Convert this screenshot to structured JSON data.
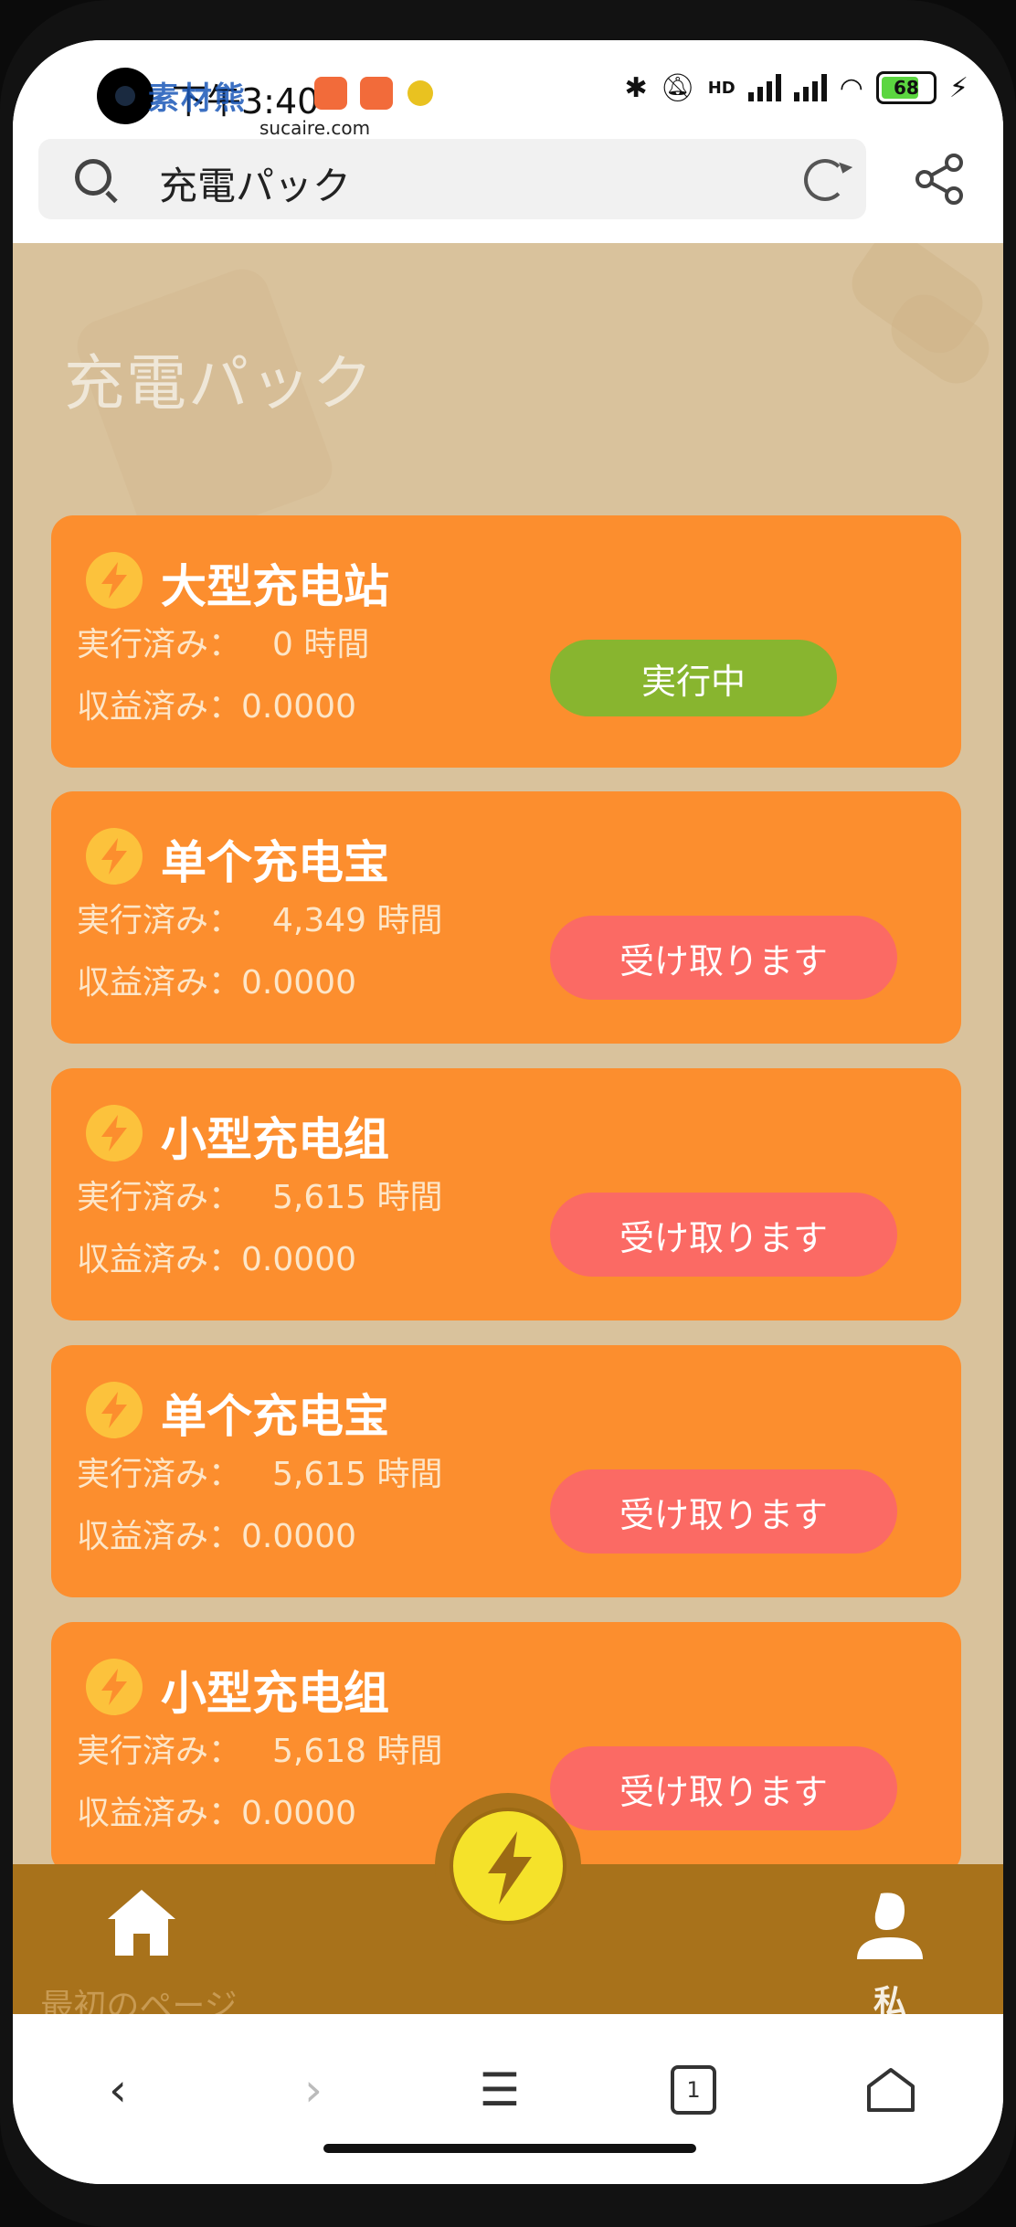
{
  "status_bar": {
    "time": "下午3:40",
    "watermark": "素材熊",
    "watermark_sub": "sucaire.com",
    "network": "HD",
    "battery": "68"
  },
  "search": {
    "query": "充電パック"
  },
  "page": {
    "title": "充電パック"
  },
  "cards": [
    {
      "name": "大型充电站",
      "run_label": "実行済み：",
      "run_value": "0 時間",
      "earn_label": "収益済み：",
      "earn_value": "0.0000",
      "button": "実行中",
      "state": "running"
    },
    {
      "name": "单个充电宝",
      "run_label": "実行済み：",
      "run_value": "4,349 時間",
      "earn_label": "収益済み：",
      "earn_value": "0.0000",
      "button": "受け取ります",
      "state": "collect"
    },
    {
      "name": "小型充电组",
      "run_label": "実行済み：",
      "run_value": "5,615 時間",
      "earn_label": "収益済み：",
      "earn_value": "0.0000",
      "button": "受け取ります",
      "state": "collect"
    },
    {
      "name": "单个充电宝",
      "run_label": "実行済み：",
      "run_value": "5,615 時間",
      "earn_label": "収益済み：",
      "earn_value": "0.0000",
      "button": "受け取ります",
      "state": "collect"
    },
    {
      "name": "小型充电组",
      "run_label": "実行済み：",
      "run_value": "5,618 時間",
      "earn_label": "収益済み：",
      "earn_value": "0.0000",
      "button": "受け取ります",
      "state": "collect"
    }
  ],
  "tabbar": {
    "home_label": "最初のページ",
    "me_label": "私"
  },
  "browser_nav": {
    "tab_count": "1"
  },
  "colors": {
    "card": "#fc8e2e",
    "running_button": "#88b52f",
    "collect_button": "#fb6a64",
    "tabbar": "#a8721b",
    "content_bg": "#d9c29c"
  }
}
